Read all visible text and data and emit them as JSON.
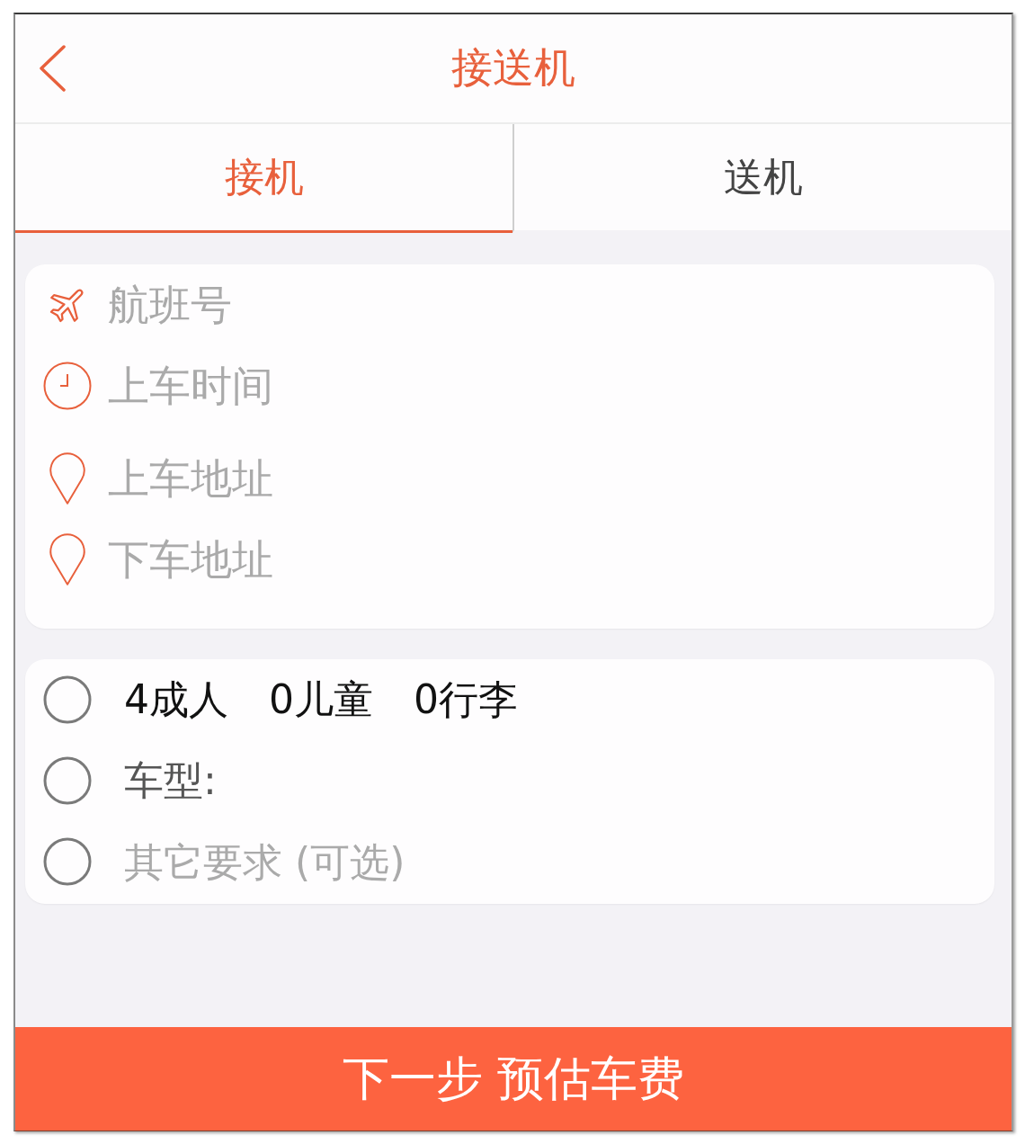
{
  "header": {
    "title": "接送机"
  },
  "tabs": [
    {
      "label": "接机",
      "selected": true
    },
    {
      "label": "送机",
      "selected": false
    }
  ],
  "trip_fields": [
    {
      "kind": "flight",
      "placeholder": "航班号"
    },
    {
      "kind": "time",
      "placeholder": "上车时间"
    },
    {
      "kind": "address",
      "placeholder": "上车地址"
    },
    {
      "kind": "address",
      "placeholder": "下车地址"
    }
  ],
  "options": [
    {
      "kind": "counts",
      "parts": [
        "4成人",
        "0儿童",
        "0行李"
      ]
    },
    {
      "kind": "label",
      "label": "车型:"
    },
    {
      "kind": "field",
      "placeholder": "其它要求 (可选)"
    }
  ],
  "next_button": {
    "label": "下一步 预估车费"
  }
}
